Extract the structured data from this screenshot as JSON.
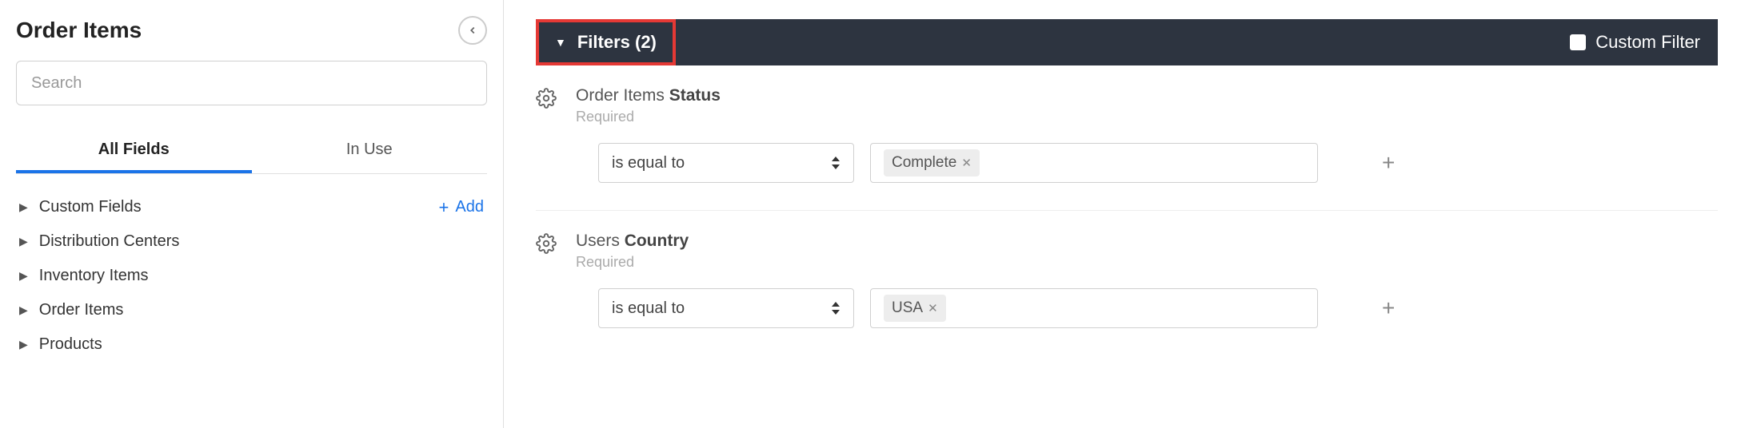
{
  "sidebar": {
    "title": "Order Items",
    "search_placeholder": "Search",
    "tabs": {
      "all": "All Fields",
      "in_use": "In Use"
    },
    "add_label": "Add",
    "categories": [
      {
        "label": "Custom Fields",
        "has_add": true
      },
      {
        "label": "Distribution Centers"
      },
      {
        "label": "Inventory Items"
      },
      {
        "label": "Order Items"
      },
      {
        "label": "Products"
      }
    ]
  },
  "filters_bar": {
    "label": "Filters (2)",
    "custom_filter": "Custom Filter"
  },
  "filters": [
    {
      "title_prefix": "Order Items ",
      "title_bold": "Status",
      "subtitle": "Required",
      "operator": "is equal to",
      "value": "Complete"
    },
    {
      "title_prefix": "Users ",
      "title_bold": "Country",
      "subtitle": "Required",
      "operator": "is equal to",
      "value": "USA"
    }
  ]
}
